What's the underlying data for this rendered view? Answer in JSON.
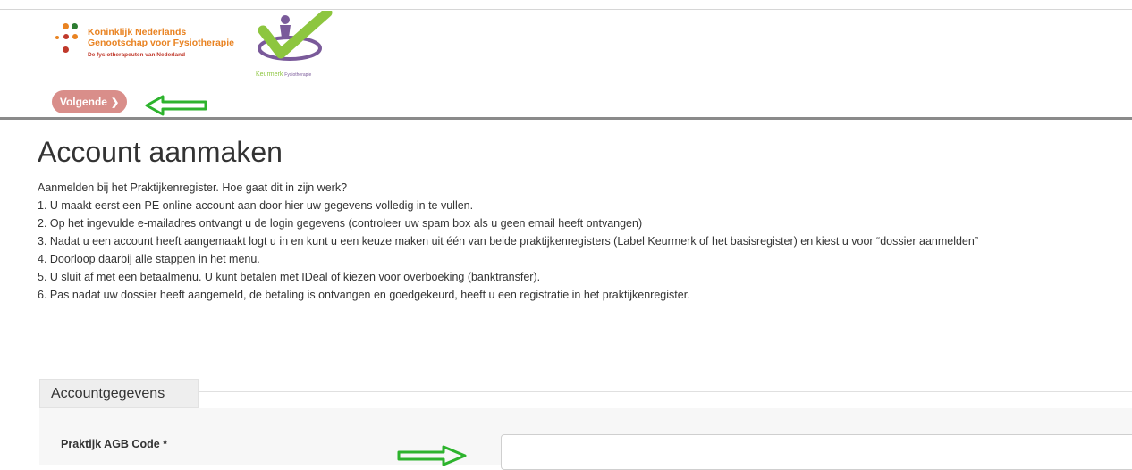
{
  "header": {
    "knfg_logo": {
      "line1": "Koninklijk Nederlands",
      "line2": "Genootschap voor Fysiotherapie",
      "tagline": "De fysiotherapeuten van Nederland"
    },
    "keurmerk_logo": {
      "name": "Keurmerk",
      "subname": "Fysiotherapie"
    },
    "next_button": {
      "label": "Volgende",
      "icon": "chevron-right-icon"
    },
    "annotation_arrow": {
      "icon": "arrow-left-icon",
      "color": "#2db32d"
    }
  },
  "main": {
    "title": "Account aanmaken",
    "intro_lines": [
      "Aanmelden bij het Praktijkenregister. Hoe gaat dit in zijn werk?",
      "1. U maakt eerst een PE online account aan door hier uw gegevens volledig in te vullen.",
      "2. Op het ingevulde e-mailadres ontvangt u de login gegevens (controleer uw spam box als u geen email heeft ontvangen)",
      "3. Nadat u een account heeft aangemaakt logt u in en kunt u een keuze maken uit één van beide praktijkenregisters (Label Keurmerk of het basisregister) en kiest u voor “dossier aanmelden”",
      "4. Doorloop daarbij alle stappen in het menu.",
      "5. U sluit af met een betaalmenu. U kunt betalen met IDeal of kiezen voor overboeking (banktransfer).",
      "6. Pas nadat uw dossier heeft aangemeld, de betaling is ontvangen en goedgekeurd, heeft u een registratie in het praktijkenregister."
    ],
    "section": {
      "legend": "Accountgegevens",
      "fields": [
        {
          "label": "Praktijk AGB Code *",
          "value": "",
          "placeholder": ""
        }
      ]
    },
    "field_arrow": {
      "icon": "arrow-right-icon",
      "color": "#2db32d"
    }
  },
  "colors": {
    "next_button": "#d98e8a",
    "knfg_orange": "#e98322",
    "knfg_red": "#c0392b",
    "keurmerk_green": "#8dc63f",
    "keurmerk_purple": "#7a5a9a",
    "annotation_green": "#2db32d"
  }
}
